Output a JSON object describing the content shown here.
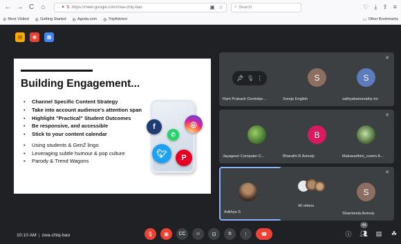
{
  "browser": {
    "url": "https://meet.google.com/zwa-chtq-bao",
    "search_placeholder": "Search",
    "nav": {
      "back": "←",
      "forward": "→",
      "reload": "C",
      "home": "⌂"
    }
  },
  "bookmarks": {
    "items": [
      {
        "label": "Most Visited",
        "icon": "gear-icon"
      },
      {
        "label": "Getting Started",
        "icon": "globe-icon"
      },
      {
        "label": "Agoda.com",
        "icon": "globe-icon"
      },
      {
        "label": "TripAdvisor",
        "icon": "globe-icon"
      }
    ],
    "other": "Other Bookmarks"
  },
  "app_icons": [
    {
      "name": "notes-icon",
      "color": "#f9ab00",
      "glyph": "▤"
    },
    {
      "name": "record-icon",
      "color": "#ea4335",
      "glyph": "◉"
    },
    {
      "name": "doc-icon",
      "color": "#4285f4",
      "glyph": "▦"
    }
  ],
  "slide": {
    "title": "Building Engagement...",
    "bold_bullets": [
      "Channel Specific Content Strategy",
      "Take into account audience's attention span",
      "Highlight \"Practical\" Student Outcomes",
      "Be responsive, and accessible",
      "Stick to your content calendar"
    ],
    "normal_bullets": [
      "Using students & GenZ lingo",
      "Leveraging subtle humour & pop culture",
      "Parody & Trend Wagons"
    ]
  },
  "participants": [
    {
      "name": "Ram Prakash Govindar...",
      "avatar_letter": "",
      "avatar_color": "",
      "hover": true
    },
    {
      "name": "Sreeja English",
      "avatar_letter": "S",
      "avatar_color": "#8d6e63"
    },
    {
      "name": "sathyabamavathy tm",
      "avatar_letter": "S",
      "avatar_color": "#5c7cbc"
    },
    {
      "name": "Jayagouri Computer C...",
      "avatar_letter": "",
      "avatar_color": "#5b8c4a"
    },
    {
      "name": "Bharathi R Avinuty",
      "avatar_letter": "B",
      "avatar_color": "#d81b60"
    },
    {
      "name": "Makavarthini_comm A...",
      "avatar_letter": "",
      "avatar_color": "#4a6b3a"
    },
    {
      "name": "Adithya S",
      "avatar_letter": "",
      "avatar_color": "#6d5a45",
      "active": true
    },
    {
      "name": "40 others",
      "avatar_letter": "",
      "avatar_color": ""
    },
    {
      "name": "Sharmeela Avinuty",
      "avatar_letter": "S",
      "avatar_color": "#8d6e63"
    }
  ],
  "bottom": {
    "time": "10:10 AM",
    "separator": "|",
    "meeting_code": "zwa-chtq-bao",
    "participant_count": "44"
  },
  "colors": {
    "danger": "#ea4335",
    "tile": "#3c4043",
    "background": "#202124",
    "accent": "#8ab4f8"
  }
}
